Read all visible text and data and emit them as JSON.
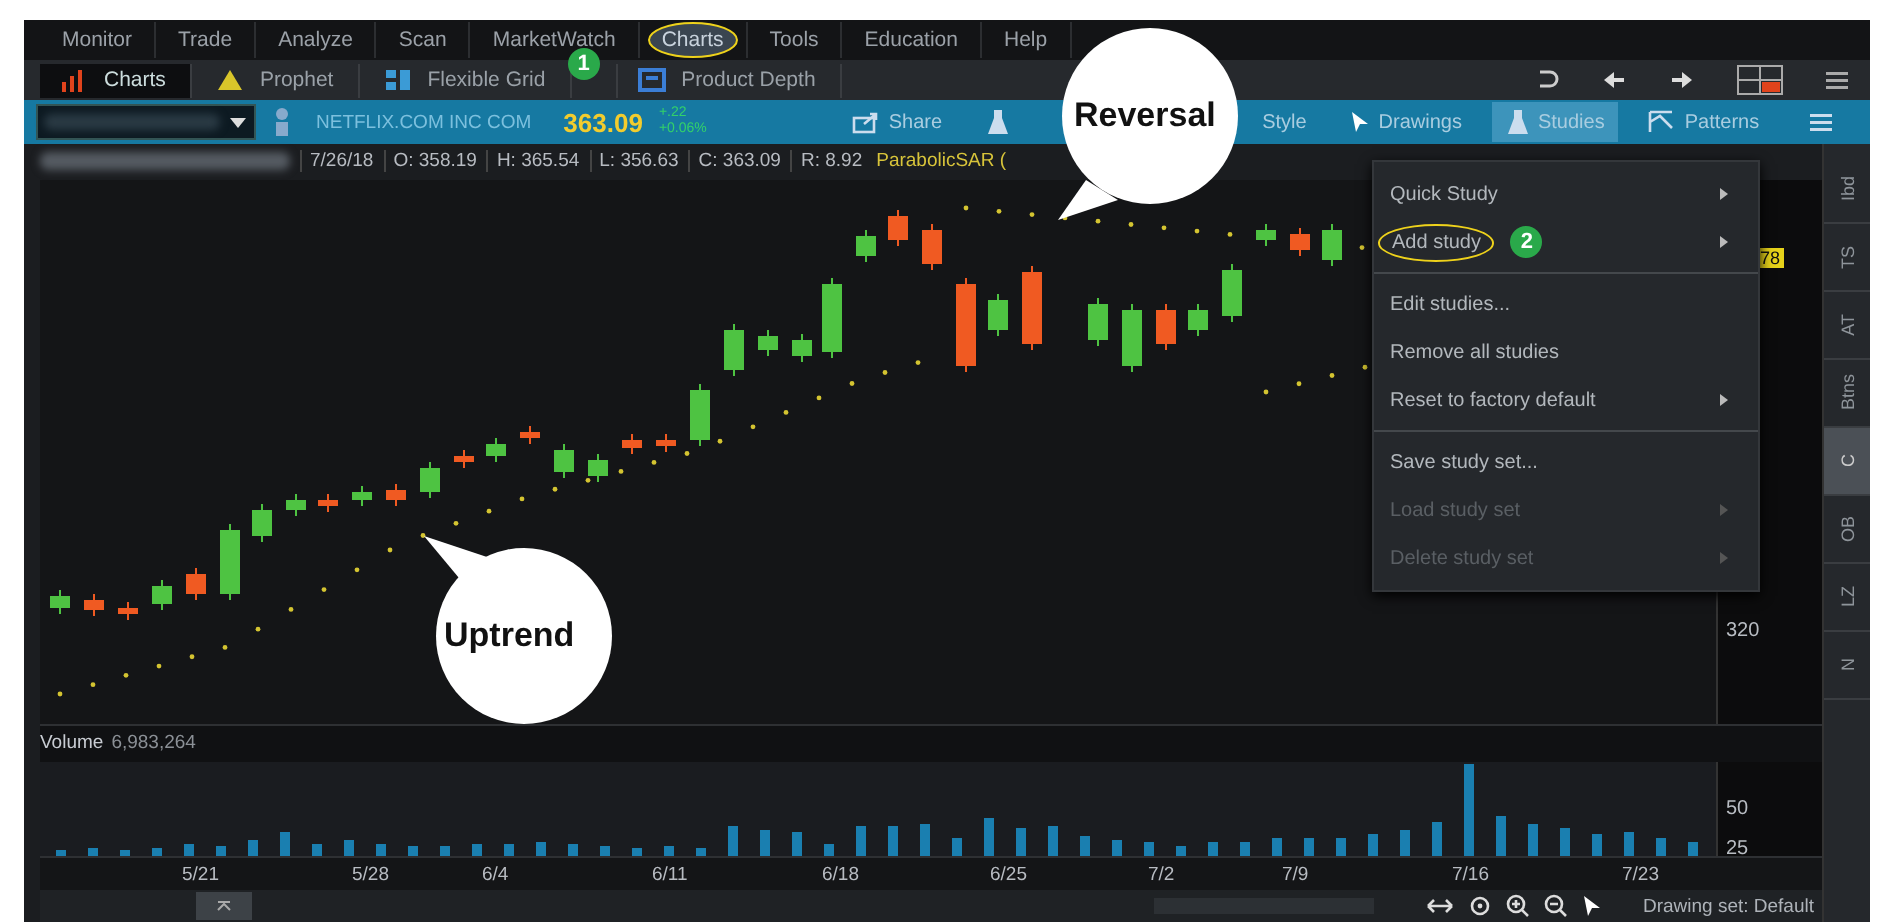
{
  "menu": [
    {
      "label": "Monitor",
      "selected": false,
      "circled": false
    },
    {
      "label": "Trade",
      "selected": false,
      "circled": false
    },
    {
      "label": "Analyze",
      "selected": false,
      "circled": false
    },
    {
      "label": "Scan",
      "selected": false,
      "circled": false
    },
    {
      "label": "MarketWatch",
      "selected": false,
      "circled": false
    },
    {
      "label": "Charts",
      "selected": true,
      "circled": true,
      "step": "1"
    },
    {
      "label": "Tools",
      "selected": false,
      "circled": false
    },
    {
      "label": "Education",
      "selected": false,
      "circled": false
    },
    {
      "label": "Help",
      "selected": false,
      "circled": false
    }
  ],
  "subtabs": [
    {
      "label": "Charts",
      "kind": "bars",
      "selected": true
    },
    {
      "label": "Prophet",
      "kind": "triangle",
      "selected": false
    },
    {
      "label": "Flexible Grid",
      "kind": "grid",
      "selected": false
    },
    {
      "label": "Product Depth",
      "kind": "depth",
      "selected": false
    }
  ],
  "symbol_bar": {
    "company": "NETFLIX.COM INC COM",
    "last": "363.09",
    "change": "+.22",
    "change_percent": "+0.06%",
    "tools": [
      {
        "kind": "share",
        "label": "Share",
        "selected": false
      },
      {
        "kind": "flask",
        "selected": false
      },
      {
        "kind": "style",
        "label": "Style",
        "selected": false
      },
      {
        "kind": "drawings",
        "label": "Drawings",
        "selected": false
      },
      {
        "kind": "studies",
        "label": "Studies",
        "selected": true
      },
      {
        "kind": "patterns",
        "label": "Patterns",
        "selected": false
      }
    ]
  },
  "quote_line": [
    "7/26/18",
    "O: 358.19",
    "H: 365.54",
    "L: 356.63",
    "C: 363.09",
    "R: 8.92"
  ],
  "study_label": "ParabolicSAR (",
  "callouts": [
    "Reversal",
    "Uptrend"
  ],
  "studies_menu": {
    "groups": [
      [
        {
          "label": "Quick Study",
          "submenu": true,
          "disabled": false,
          "circled": false
        },
        {
          "label": "Add study",
          "submenu": true,
          "disabled": false,
          "circled": true,
          "step": "2"
        }
      ],
      [
        {
          "label": "Edit studies...",
          "submenu": false,
          "disabled": false,
          "circled": false
        },
        {
          "label": "Remove all studies",
          "submenu": false,
          "disabled": false,
          "circled": false
        },
        {
          "label": "Reset to factory default",
          "submenu": true,
          "disabled": false,
          "circled": false
        }
      ],
      [
        {
          "label": "Save study set...",
          "submenu": false,
          "disabled": false,
          "circled": false
        },
        {
          "label": "Load study set",
          "submenu": true,
          "disabled": true,
          "circled": false
        },
        {
          "label": "Delete study set",
          "submenu": true,
          "disabled": true,
          "circled": false
        }
      ]
    ]
  },
  "price_axis": {
    "labels": [
      "320"
    ],
    "price_tag": "78"
  },
  "side_tabs": [
    {
      "label": "Ibd",
      "selected": false
    },
    {
      "label": "TS",
      "selected": false
    },
    {
      "label": "AT",
      "selected": false
    },
    {
      "label": "Btns",
      "selected": false
    },
    {
      "label": "C",
      "selected": true
    },
    {
      "label": "OB",
      "selected": false
    },
    {
      "label": "LZ",
      "selected": false
    },
    {
      "label": "N",
      "selected": false
    }
  ],
  "volume": {
    "label": "Volume",
    "value": "6,983,264",
    "ticks": [
      "50",
      "25"
    ]
  },
  "dates": [
    "5/21",
    "5/28",
    "6/4",
    "6/11",
    "6/18",
    "6/25",
    "7/2",
    "7/9",
    "7/16",
    "7/23"
  ],
  "status_bar": {
    "drawing_set": "Drawing set: Default"
  }
}
